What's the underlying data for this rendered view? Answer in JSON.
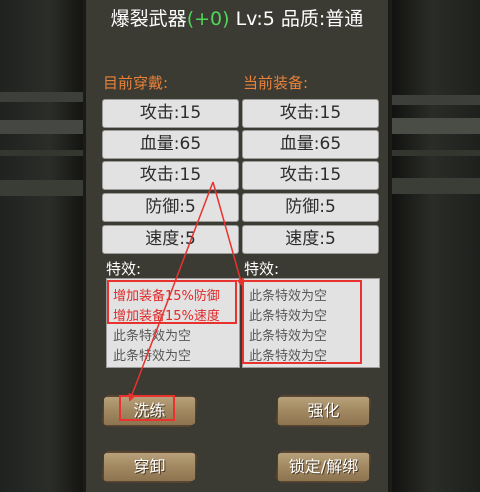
{
  "title": {
    "name": "爆裂武器",
    "bonus": "(+0)",
    "level": "Lv:5",
    "quality": "品质:普通"
  },
  "columns": {
    "current_label": "目前穿戴:",
    "equipped_label": "当前装备:"
  },
  "current_stats": [
    "攻击:15",
    "血量:65",
    "攻击:15",
    "防御:5",
    "速度:5"
  ],
  "equipped_stats": [
    "攻击:15",
    "血量:65",
    "攻击:15",
    "防御:5",
    "速度:5"
  ],
  "effects": {
    "left_label": "特效:",
    "right_label": "特效:",
    "left": [
      "增加装备15%防御",
      "增加装备15%速度",
      "此条特效为空",
      "此条特效为空"
    ],
    "right": [
      "此条特效为空",
      "此条特效为空",
      "此条特效为空",
      "此条特效为空"
    ]
  },
  "buttons": {
    "reroll": "洗练",
    "enhance": "强化",
    "wear": "穿卸",
    "lock": "锁定/解绑"
  },
  "annotation_color": "#e8322e",
  "accent_bonus_color": "#4fd65a",
  "header_color": "#e8823a"
}
